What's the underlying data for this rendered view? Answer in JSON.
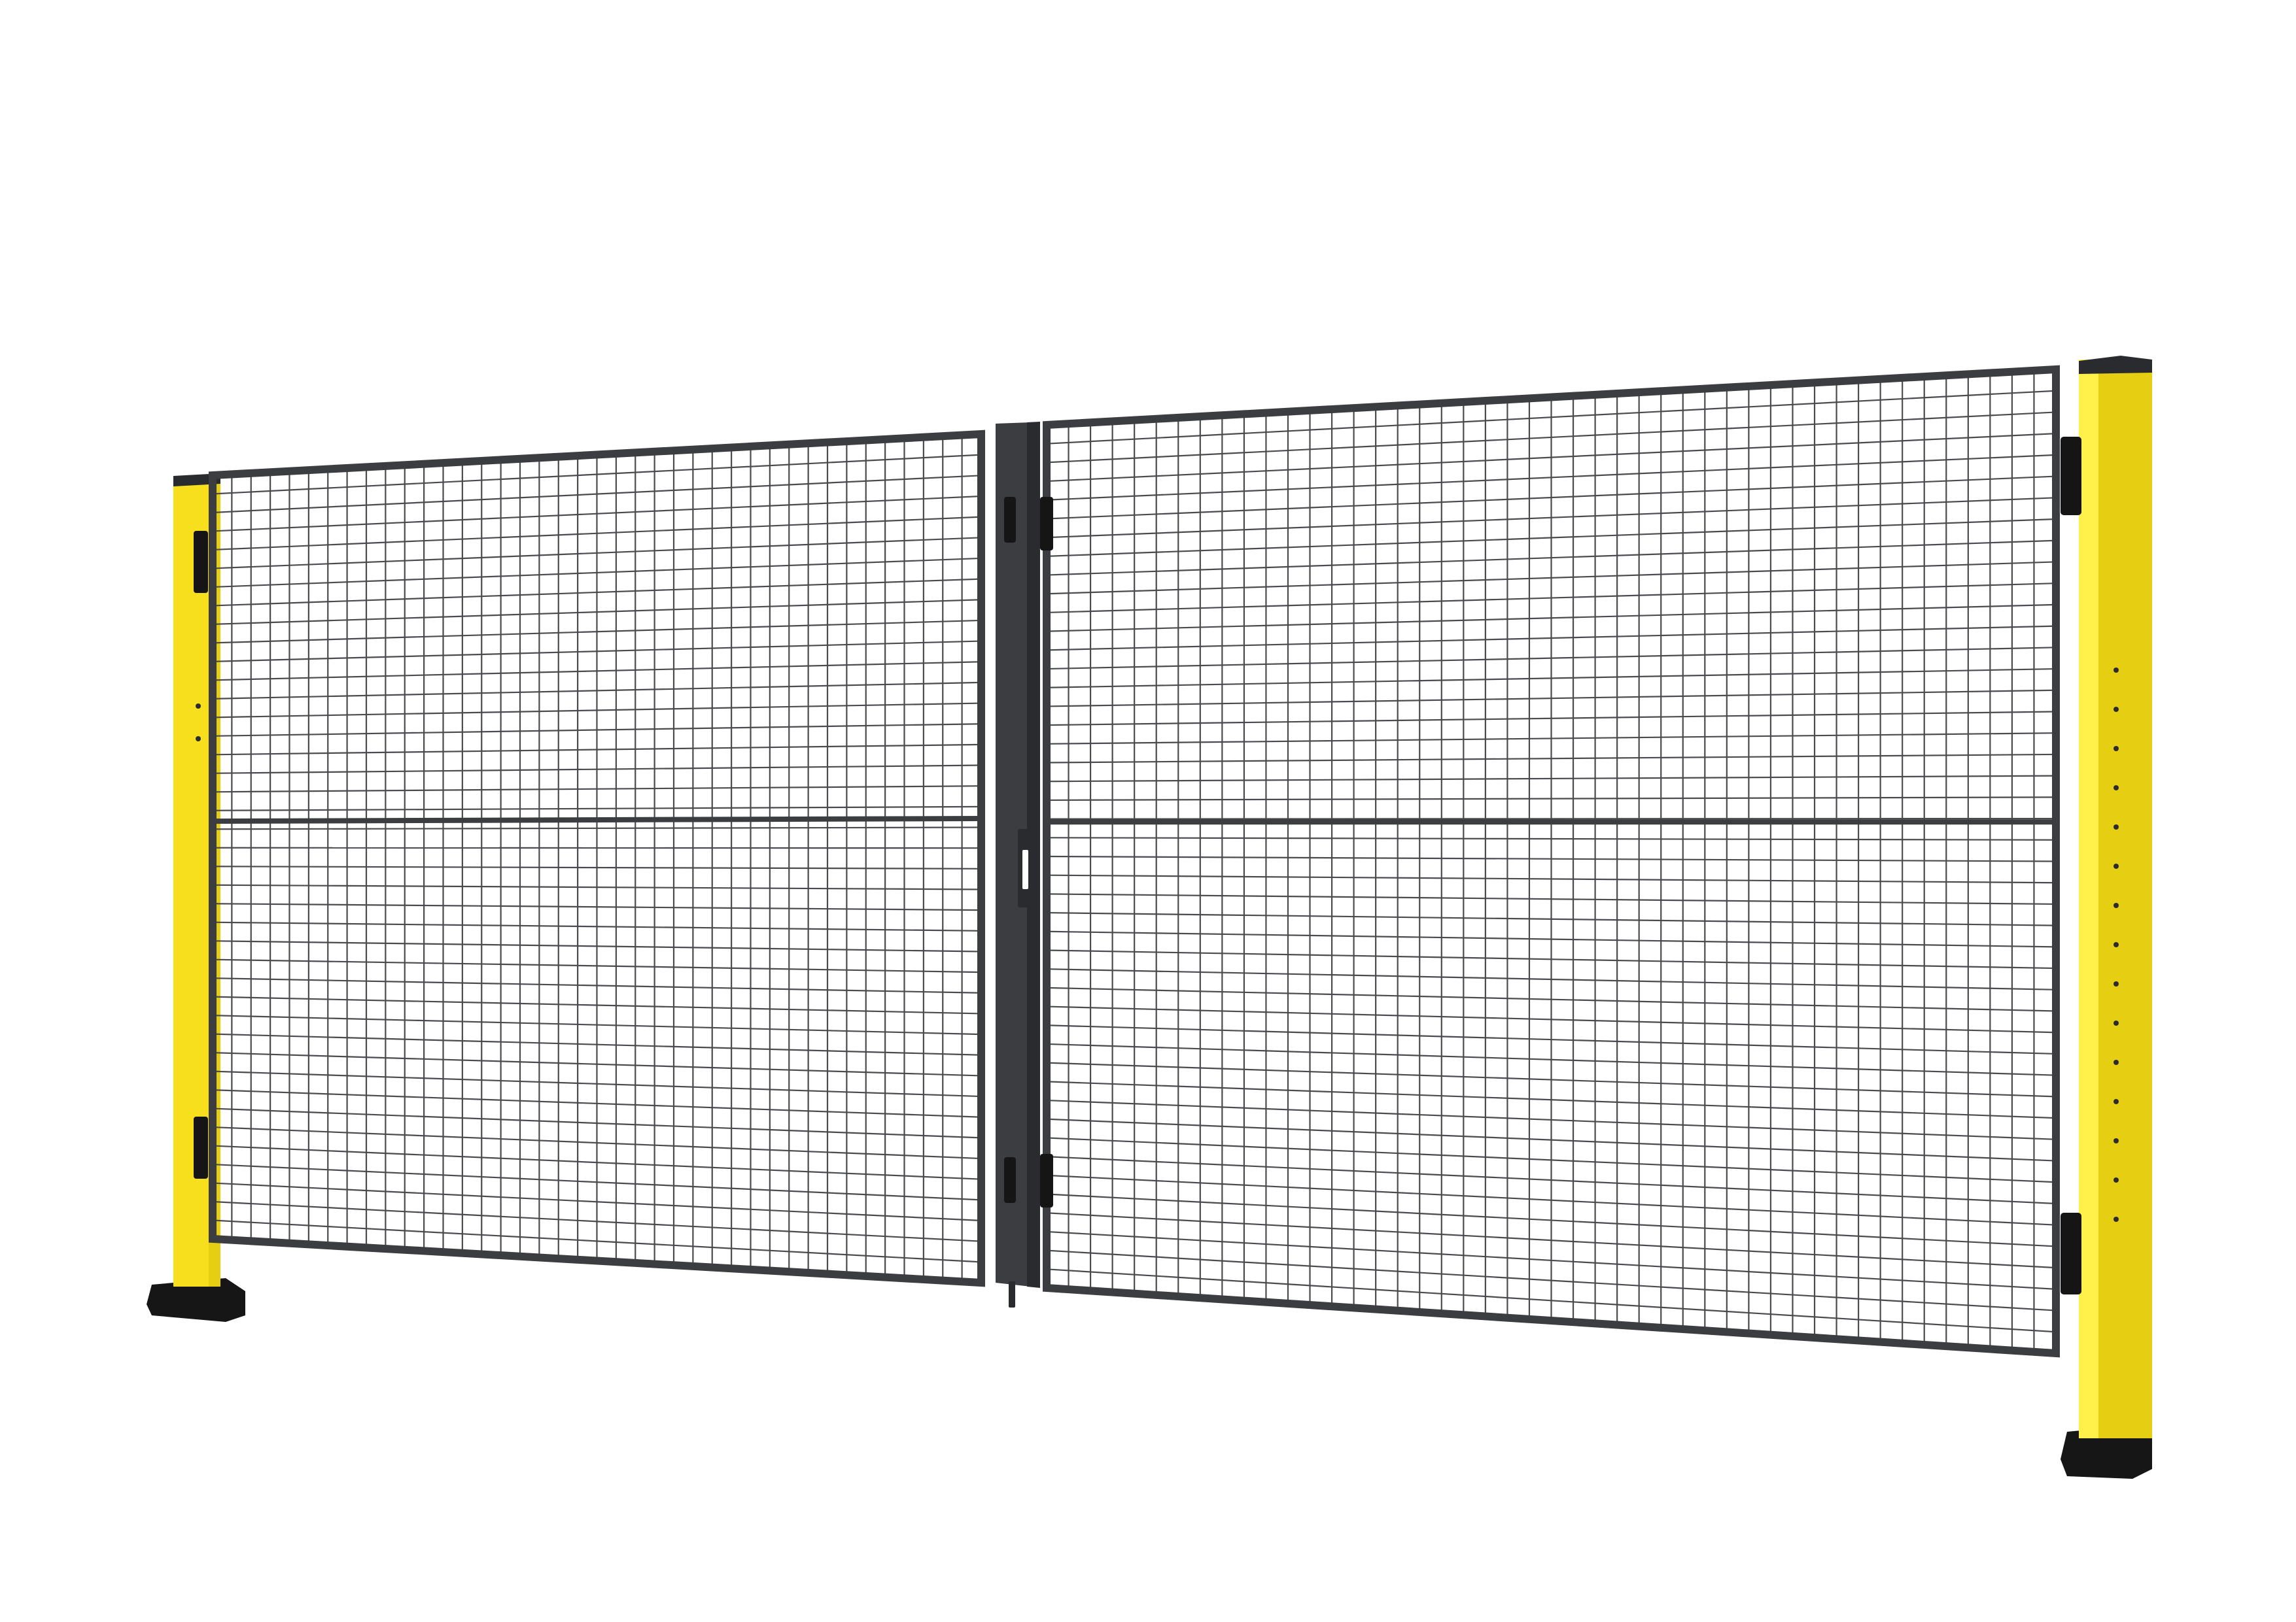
{
  "scene": {
    "subject": "double-leaf-mesh-gate",
    "colors": {
      "background": "#ffffff",
      "post_yellow": "#f7df1e",
      "post_yellow_shade": "#e6ce12",
      "post_yellow_highlight": "#fff04a",
      "frame_dark": "#3c3d40",
      "frame_darker": "#2a2b2e",
      "mesh_wire": "#4a4b4f",
      "foot_black": "#161616",
      "hinge_black": "#151515",
      "hole_dark": "#2b2b2b"
    },
    "icons": {
      "hinge": "hinge-icon",
      "latch": "latch-icon",
      "drop-bolt": "drop-bolt-icon"
    }
  }
}
